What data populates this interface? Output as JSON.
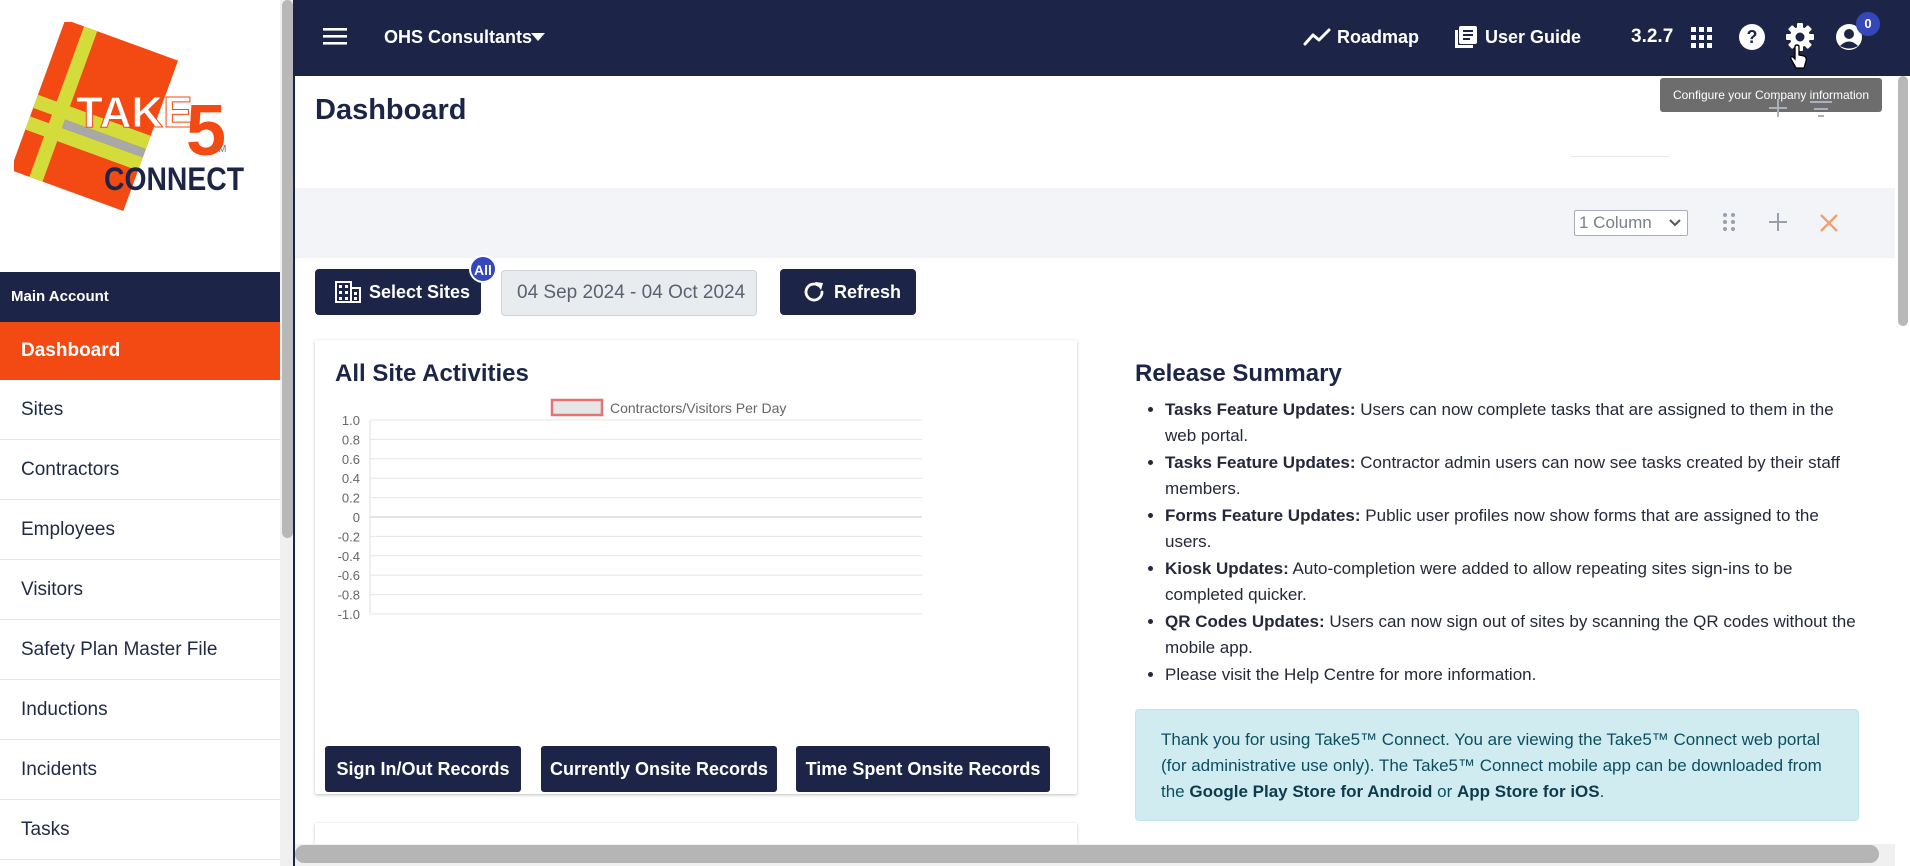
{
  "logo": {
    "word1": "TAKE",
    "word2": "5",
    "word3": "CONNECT",
    "tm": "TM"
  },
  "sidebar": {
    "account_header": "Main Account",
    "items": [
      {
        "label": "Dashboard",
        "active": true
      },
      {
        "label": "Sites"
      },
      {
        "label": "Contractors"
      },
      {
        "label": "Employees"
      },
      {
        "label": "Visitors"
      },
      {
        "label": "Safety Plan Master File"
      },
      {
        "label": "Inductions"
      },
      {
        "label": "Incidents"
      },
      {
        "label": "Tasks"
      }
    ]
  },
  "topbar": {
    "org_name": "OHS Consultants",
    "roadmap_label": "Roadmap",
    "guide_label": "User Guide",
    "version": "3.2.7",
    "notification_count": "0",
    "icons": [
      "menu-icon",
      "trend-icon",
      "book-icon",
      "apps-grid-icon",
      "help-icon",
      "gear-icon",
      "account-icon"
    ]
  },
  "tooltip": "Configure your Company information",
  "page": {
    "title": "Dashboard",
    "column_select": "1 Column",
    "select_sites_label": "Select Sites",
    "sites_badge": "All",
    "date_range": "04 Sep 2024 - 04 Oct 2024",
    "refresh_label": "Refresh"
  },
  "activity": {
    "title": "All Site Activities",
    "buttons": [
      "Sign In/Out Records",
      "Currently Onsite Records",
      "Time Spent Onsite Records"
    ]
  },
  "chart_data": {
    "type": "line",
    "series": [
      {
        "name": "Contractors/Visitors Per Day",
        "values": []
      }
    ],
    "ylim": [
      -1.0,
      1.0
    ],
    "yticks": [
      "1.0",
      "0.8",
      "0.6",
      "0.4",
      "0.2",
      "0",
      "-0.2",
      "-0.4",
      "-0.6",
      "-0.8",
      "-1.0"
    ],
    "grid": true,
    "legend": "top",
    "colors": {
      "legend_border": "#e57373",
      "legend_fill": "#e6e6e6"
    }
  },
  "release": {
    "title": "Release Summary",
    "items": [
      {
        "bold": "Tasks Feature Updates:",
        "text": " Users can now complete tasks that are assigned to them in the web portal."
      },
      {
        "bold": "Tasks Feature Updates:",
        "text": " Contractor admin users can now see tasks created by their staff members."
      },
      {
        "bold": "Forms Feature Updates:",
        "text": " Public user profiles now show forms that are assigned to the users."
      },
      {
        "bold": "Kiosk Updates:",
        "text": " Auto-completion were added to allow repeating sites sign-ins to be completed quicker."
      },
      {
        "bold": "QR Codes Updates:",
        "text": " Users can now sign out of sites by scanning the QR codes without the mobile app."
      },
      {
        "bold": "",
        "text": "Please visit the Help Centre for more information."
      }
    ],
    "info": {
      "part1": "Thank you for using Take5™ Connect. You are viewing the Take5™ Connect web portal (for administrative use only). The Take5™ Connect mobile app can be downloaded from the ",
      "android": "Google Play Store for Android",
      "or": " or ",
      "ios": "App Store for iOS",
      "end": "."
    }
  },
  "colors": {
    "navy": "#1c2547",
    "accent": "#f24a12",
    "badge": "#3648b9",
    "info_bg": "#d1ecf1"
  }
}
